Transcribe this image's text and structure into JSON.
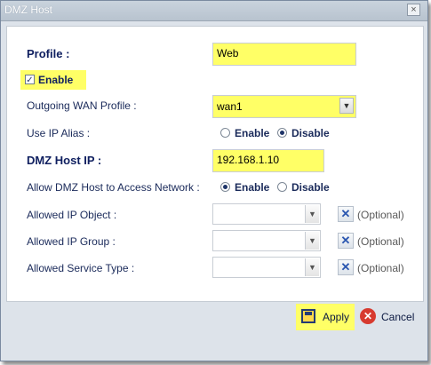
{
  "window": {
    "title": "DMZ Host",
    "close_glyph": "×"
  },
  "form": {
    "profile": {
      "label": "Profile :",
      "value": "Web"
    },
    "enable": {
      "label": "Enable",
      "checked": true
    },
    "outgoing_wan": {
      "label": "Outgoing WAN Profile :",
      "value": "wan1"
    },
    "use_ip_alias": {
      "label": "Use IP Alias :",
      "options": [
        "Enable",
        "Disable"
      ],
      "selected": "Disable"
    },
    "dmz_host_ip": {
      "label": "DMZ Host IP :",
      "value": "192.168.1.10"
    },
    "allow_access": {
      "label": "Allow DMZ Host to Access Network :",
      "options": [
        "Enable",
        "Disable"
      ],
      "selected": "Enable"
    },
    "allowed_ip_object": {
      "label": "Allowed IP Object :",
      "value": "",
      "optional": "(Optional)"
    },
    "allowed_ip_group": {
      "label": "Allowed IP Group :",
      "value": "",
      "optional": "(Optional)"
    },
    "allowed_service_type": {
      "label": "Allowed Service Type :",
      "value": "",
      "optional": "(Optional)"
    }
  },
  "footer": {
    "apply_label": "Apply",
    "cancel_label": "Cancel"
  },
  "colors": {
    "highlight": "#ffff66",
    "label": "#1a2a5a",
    "cancel_icon": "#d73a2f"
  },
  "icons": {
    "dropdown": "chevron-down-icon",
    "clear": "close-icon",
    "apply": "save-icon",
    "cancel": "cancel-icon"
  }
}
